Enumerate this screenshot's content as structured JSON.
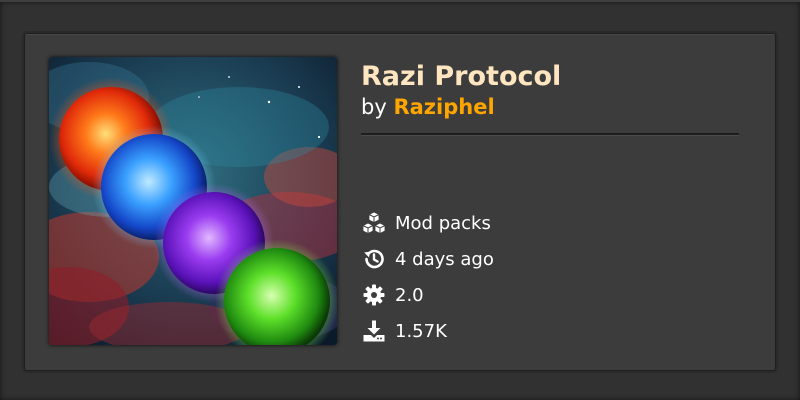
{
  "mod": {
    "title": "Razi Protocol",
    "by_prefix": "by",
    "author": "Raziphel",
    "thumbnail": "four glowing suns (red, blue, purple, green) over a nebula"
  },
  "stats": [
    {
      "icon": "cubes-icon",
      "label": "Mod packs"
    },
    {
      "icon": "history-icon",
      "label": "4 days ago"
    },
    {
      "icon": "gear-icon",
      "label": "2.0"
    },
    {
      "icon": "download-icon",
      "label": "1.57K"
    }
  ],
  "colors": {
    "title": "#ffe6c0",
    "author": "#ffa500",
    "card_bg": "#3c3c3c",
    "page_bg": "#313131"
  }
}
